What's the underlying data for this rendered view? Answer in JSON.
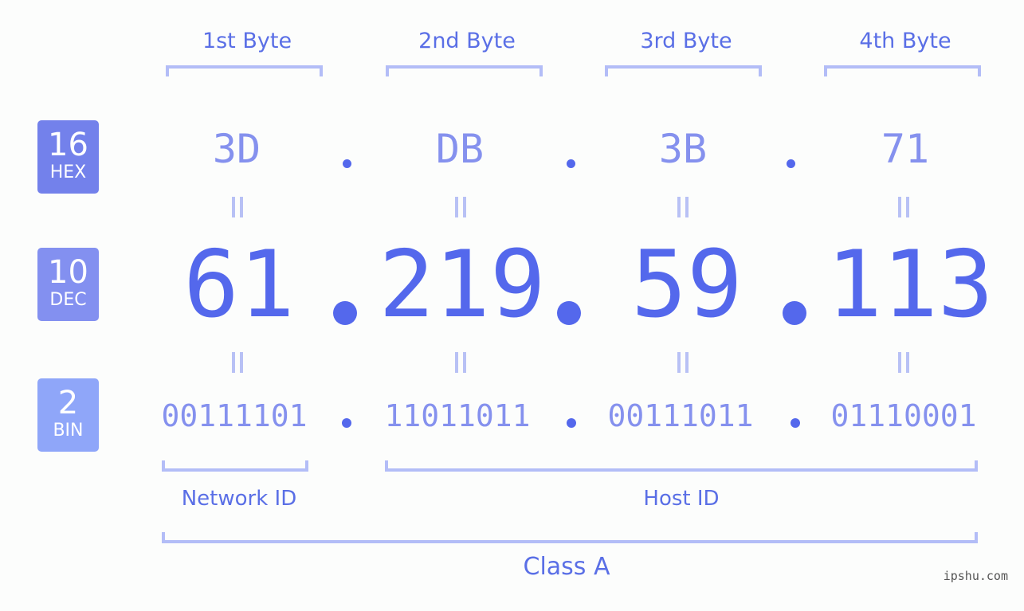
{
  "bytes": [
    {
      "label": "1st Byte",
      "hex": "3D",
      "dec": "61",
      "bin": "00111101"
    },
    {
      "label": "2nd Byte",
      "hex": "DB",
      "dec": "219",
      "bin": "11011011"
    },
    {
      "label": "3rd Byte",
      "hex": "3B",
      "dec": "59",
      "bin": "00111011"
    },
    {
      "label": "4th Byte",
      "hex": "71",
      "dec": "113",
      "bin": "01110001"
    }
  ],
  "badges": {
    "hex": {
      "num": "16",
      "label": "HEX",
      "color": "#7381eb"
    },
    "dec": {
      "num": "10",
      "label": "DEC",
      "color": "#8390f0"
    },
    "bin": {
      "num": "2",
      "label": "BIN",
      "color": "#8fa6f9"
    }
  },
  "separator": ".",
  "segments": {
    "network": "Network ID",
    "host": "Host ID",
    "class": "Class A"
  },
  "watermark": "ipshu.com",
  "colors": {
    "primary": "#5468ec",
    "secondary": "#8591ee",
    "bracket": "#b3bdf7",
    "background": "#fcfdfc"
  }
}
